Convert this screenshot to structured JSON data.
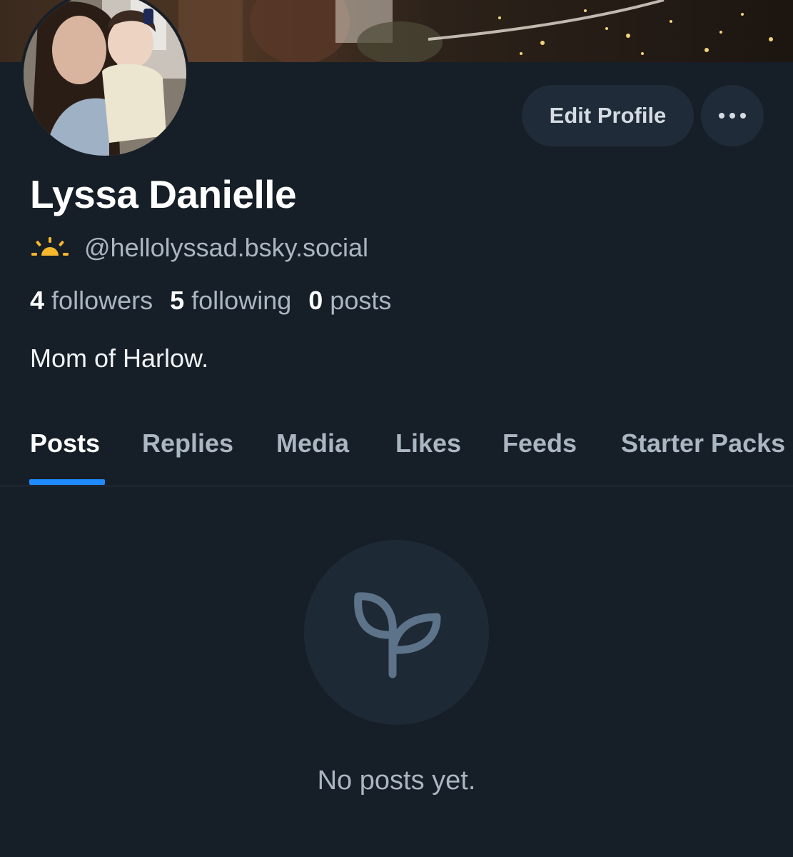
{
  "profile": {
    "display_name": "Lyssa Danielle",
    "handle": "@hellolyssad.bsky.social",
    "handle_icon": "sunrise-icon",
    "bio": "Mom of Harlow."
  },
  "actions": {
    "edit_profile_label": "Edit Profile",
    "more_icon": "ellipsis-icon"
  },
  "stats": {
    "followers": {
      "count": "4",
      "label": "followers"
    },
    "following": {
      "count": "5",
      "label": "following"
    },
    "posts": {
      "count": "0",
      "label": "posts"
    }
  },
  "tabs": [
    {
      "label": "Posts",
      "active": true
    },
    {
      "label": "Replies"
    },
    {
      "label": "Media"
    },
    {
      "label": "Likes"
    },
    {
      "label": "Feeds"
    },
    {
      "label": "Starter Packs"
    }
  ],
  "empty_state": {
    "icon": "seedling-icon",
    "message": "No posts yet."
  },
  "colors": {
    "background": "#161e27",
    "button_bg": "#1f2b38",
    "accent": "#208bfe",
    "muted_text": "#aab6c2",
    "sun_icon": "#f5b72c"
  }
}
